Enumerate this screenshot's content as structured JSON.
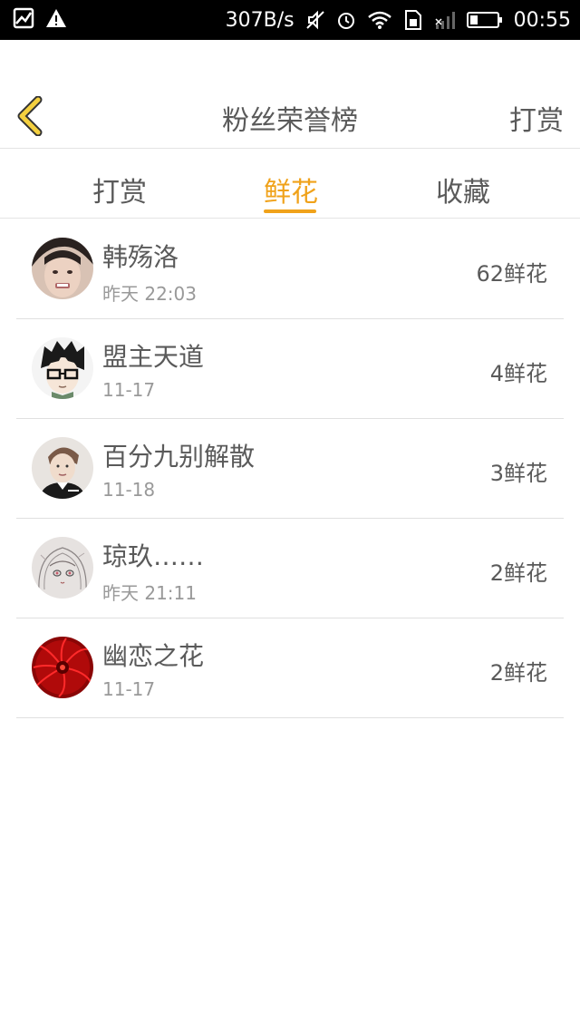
{
  "status_bar": {
    "speed": "307B/s",
    "time": "00:55"
  },
  "header": {
    "title": "粉丝荣誉榜",
    "right_action": "打赏",
    "back_icon": "chevron-left-icon",
    "accent_color": "#f0a21a"
  },
  "tabs": [
    {
      "label": "打赏",
      "active": false
    },
    {
      "label": "鲜花",
      "active": true
    },
    {
      "label": "收藏",
      "active": false
    }
  ],
  "list": [
    {
      "name": "韩殇洛",
      "time": "昨天 22:03",
      "amount": "62鲜花",
      "avatar": "avatar-girl-photo"
    },
    {
      "name": "盟主天道",
      "time": "11-17",
      "amount": "4鲜花",
      "avatar": "avatar-anime-glasses"
    },
    {
      "name": "百分九别解散",
      "time": "11-18",
      "amount": "3鲜花",
      "avatar": "avatar-boy-photo"
    },
    {
      "name": "琼玖……",
      "time": "昨天 21:11",
      "amount": "2鲜花",
      "avatar": "avatar-anime-sketch"
    },
    {
      "name": "幽恋之花",
      "time": "11-17",
      "amount": "2鲜花",
      "avatar": "avatar-red-flower"
    }
  ]
}
